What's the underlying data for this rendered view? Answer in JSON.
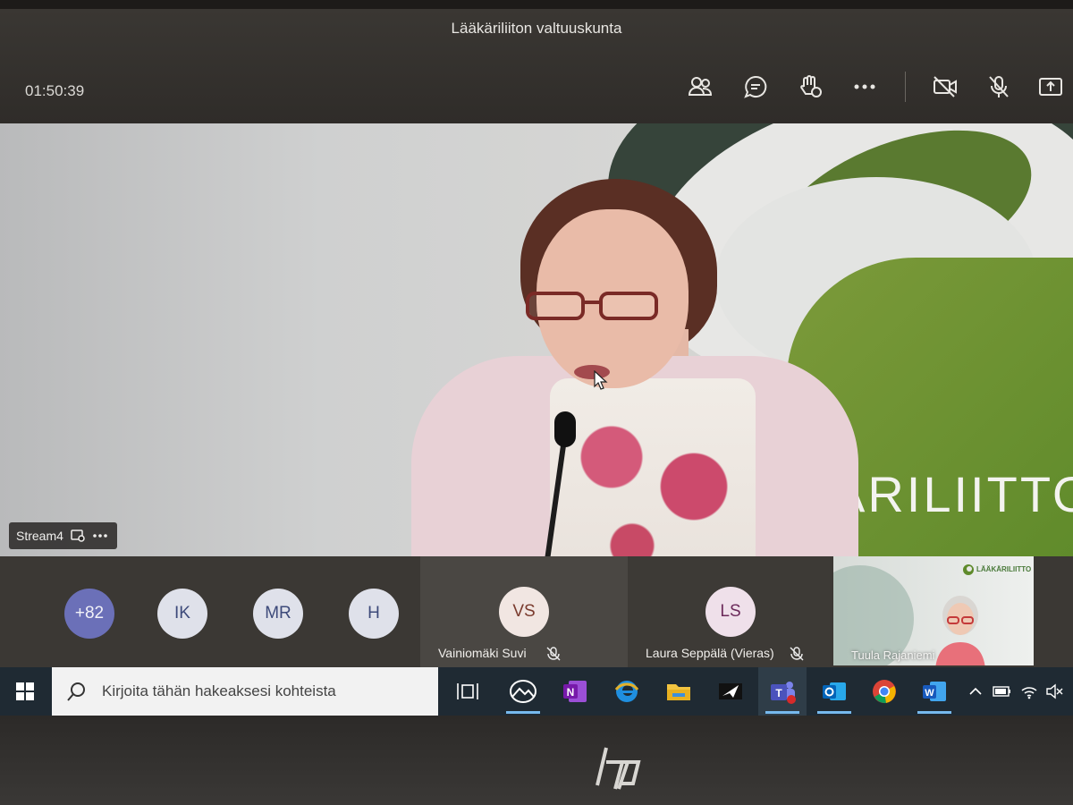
{
  "meeting": {
    "title": "Lääkäriliiton valtuuskunta",
    "elapsed": "01:50:39",
    "header_buttons": [
      "people-icon",
      "chat-icon",
      "reactions-icon",
      "more-icon",
      "camera-off-icon",
      "mic-off-icon",
      "share-icon"
    ]
  },
  "stage": {
    "stream_label": "Stream4",
    "background_brand": "ÄRILIITTO"
  },
  "participants": {
    "overflow_count": "+82",
    "avatars": [
      {
        "initials": "IK"
      },
      {
        "initials": "MR"
      },
      {
        "initials": "H"
      }
    ],
    "tiles": [
      {
        "initials": "VS",
        "name": "Vainiomäki Suvi",
        "muted": true
      },
      {
        "initials": "LS",
        "name": "Laura Seppälä (Vieras)",
        "muted": true
      }
    ],
    "video_tile": {
      "name": "Tuula Rajaniemi",
      "logo_text": "LÄÄKÄRILIITTO"
    }
  },
  "taskbar": {
    "search_placeholder": "Kirjoita tähän hakeaksesi kohteista",
    "apps": [
      "task-view",
      "photos",
      "onenote",
      "edge-legacy",
      "file-explorer",
      "mail-send",
      "teams",
      "outlook",
      "chrome",
      "word"
    ]
  },
  "colors": {
    "teams_avatar_more": "#6b70b8",
    "taskbar": "#1f2a33",
    "brand_green": "#6d9432"
  }
}
